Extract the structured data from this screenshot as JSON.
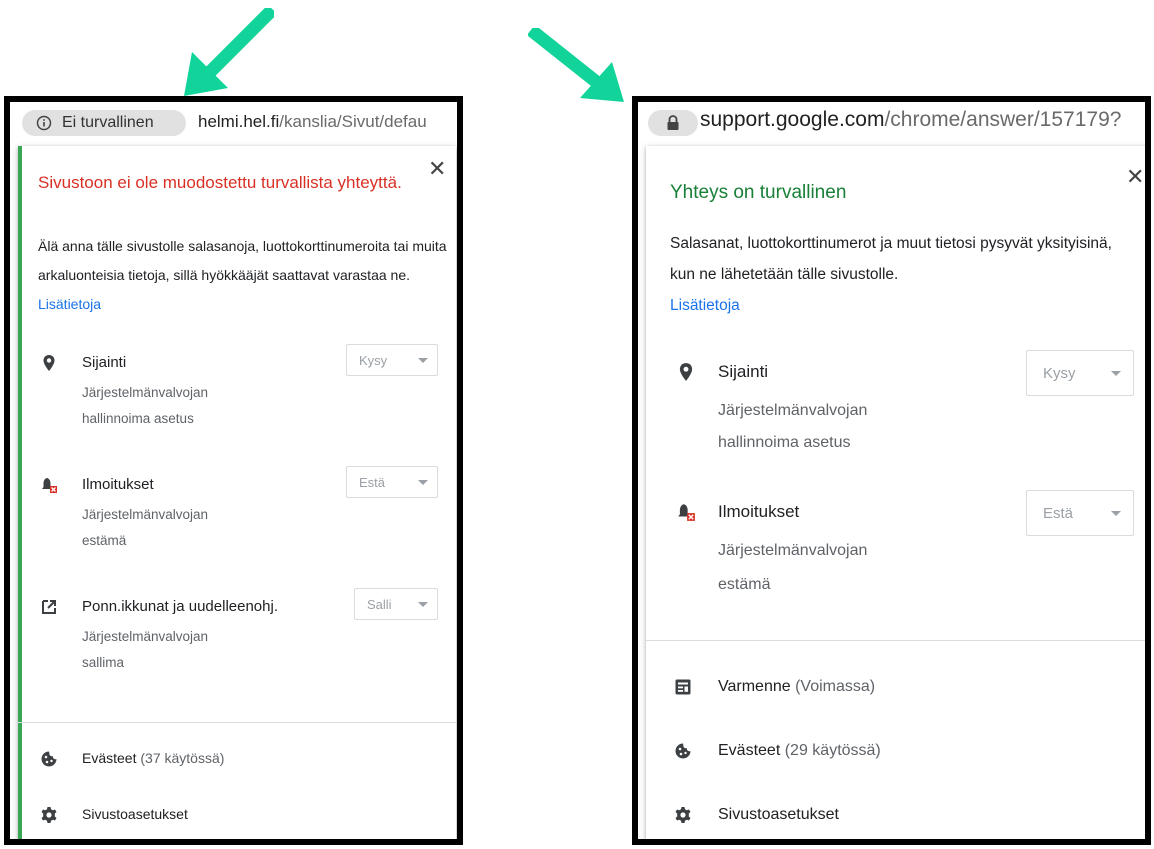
{
  "colors": {
    "arrow": "#12d39a",
    "insecure_red": "#d93025",
    "secure_green": "#188038",
    "link_blue": "#1a73e8"
  },
  "left": {
    "badge_icon": "info-icon",
    "badge_text": "Ei turvallinen",
    "url_host": "helmi.hel.fi",
    "url_path": "/kanslia/Sivut/defau",
    "title": "Sivustoon ei ole muodostettu turvallista yhteyttä.",
    "description": "Älä anna tälle sivustolle salasanoja, luottokorttinumeroita tai muita arkaluonteisia tietoja, sillä hyökkääjät saattavat varastaa ne.",
    "learn_more": "Lisätietoja",
    "permissions": [
      {
        "icon": "location-pin-icon",
        "label": "Sijainti",
        "sub1": "Järjestelmänvalvojan",
        "sub2": "hallinnoima asetus",
        "value": "Kysy"
      },
      {
        "icon": "notifications-blocked-icon",
        "label": "Ilmoitukset",
        "sub1": "Järjestelmänvalvojan",
        "sub2": "estämä",
        "value": "Estä"
      },
      {
        "icon": "popups-redirects-icon",
        "label": "Ponn.ikkunat ja uudelleenohj.",
        "sub1": "Järjestelmänvalvojan",
        "sub2": "sallima",
        "value": "Salli"
      }
    ],
    "cookies_label": "Evästeet",
    "cookies_count": "(37 käytössä)",
    "site_settings": "Sivustoasetukset"
  },
  "right": {
    "badge_icon": "lock-icon",
    "url_host": "support.google.com",
    "url_path": "/chrome/answer/157179?",
    "title": "Yhteys on turvallinen",
    "description": "Salasanat, luottokorttinumerot ja muut tietosi pysyvät yksityisinä, kun ne lähetetään tälle sivustolle.",
    "learn_more": "Lisätietoja",
    "permissions": [
      {
        "icon": "location-pin-icon",
        "label": "Sijainti",
        "sub1": "Järjestelmänvalvojan",
        "sub2": "hallinnoima asetus",
        "value": "Kysy"
      },
      {
        "icon": "notifications-blocked-icon",
        "label": "Ilmoitukset",
        "sub1": "Järjestelmänvalvojan",
        "sub2": "estämä",
        "value": "Estä"
      }
    ],
    "certificate_label": "Varmenne",
    "certificate_status": "(Voimassa)",
    "cookies_label": "Evästeet",
    "cookies_count": "(29 käytössä)",
    "site_settings": "Sivustoasetukset"
  }
}
